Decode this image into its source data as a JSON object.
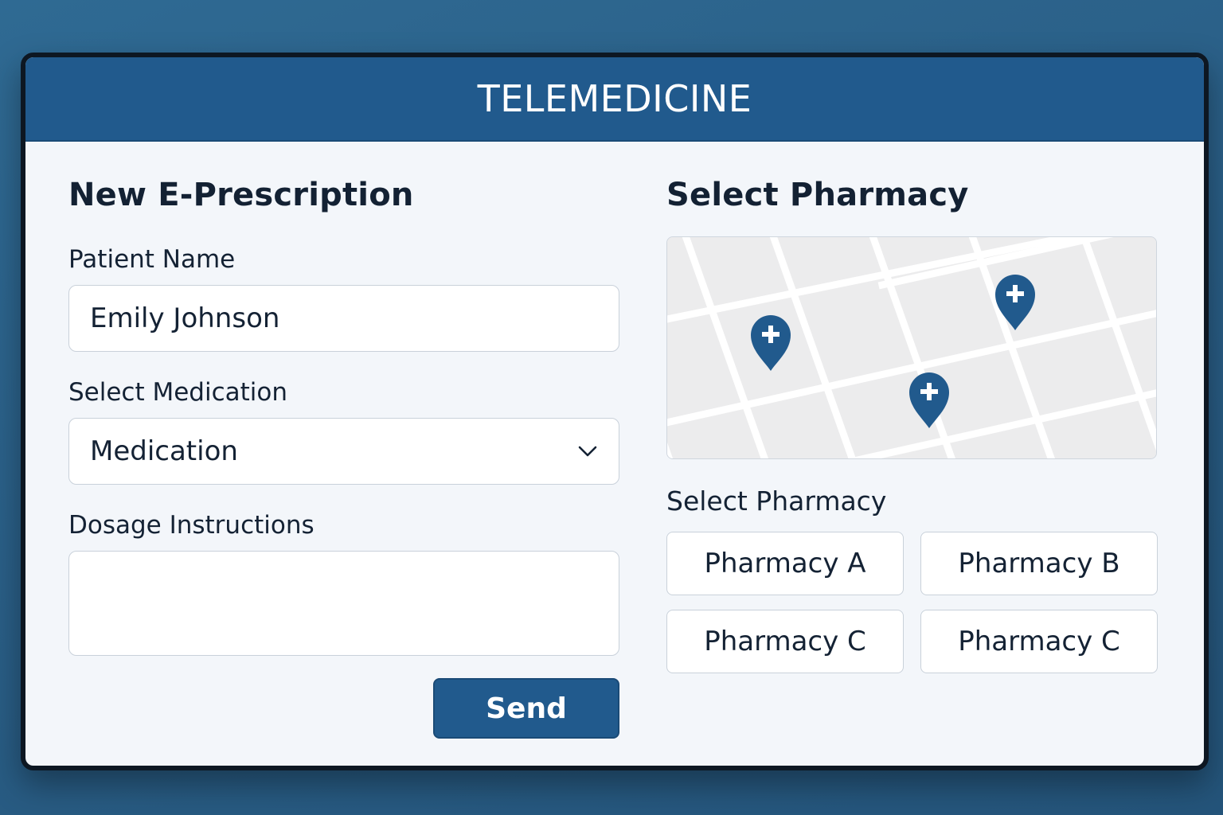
{
  "app": {
    "title": "TELEMEDICINE"
  },
  "prescription": {
    "heading": "New E-Prescription",
    "patient_name_label": "Patient Name",
    "patient_name_value": "Emily Johnson",
    "medication_label": "Select Medication",
    "medication_value": "Medication",
    "dosage_label": "Dosage Instructions",
    "dosage_value": "",
    "send_label": "Send"
  },
  "pharmacy": {
    "heading": "Select Pharmacy",
    "list_heading": "Select Pharmacy",
    "map_icons": [
      "pharmacy-pin-icon",
      "pharmacy-pin-icon",
      "pharmacy-pin-icon"
    ],
    "options": [
      "Pharmacy A",
      "Pharmacy B",
      "Pharmacy C",
      "Pharmacy C"
    ]
  },
  "colors": {
    "brand": "#215a8d",
    "background": "#2a5f87",
    "panel": "#f3f6fa"
  }
}
